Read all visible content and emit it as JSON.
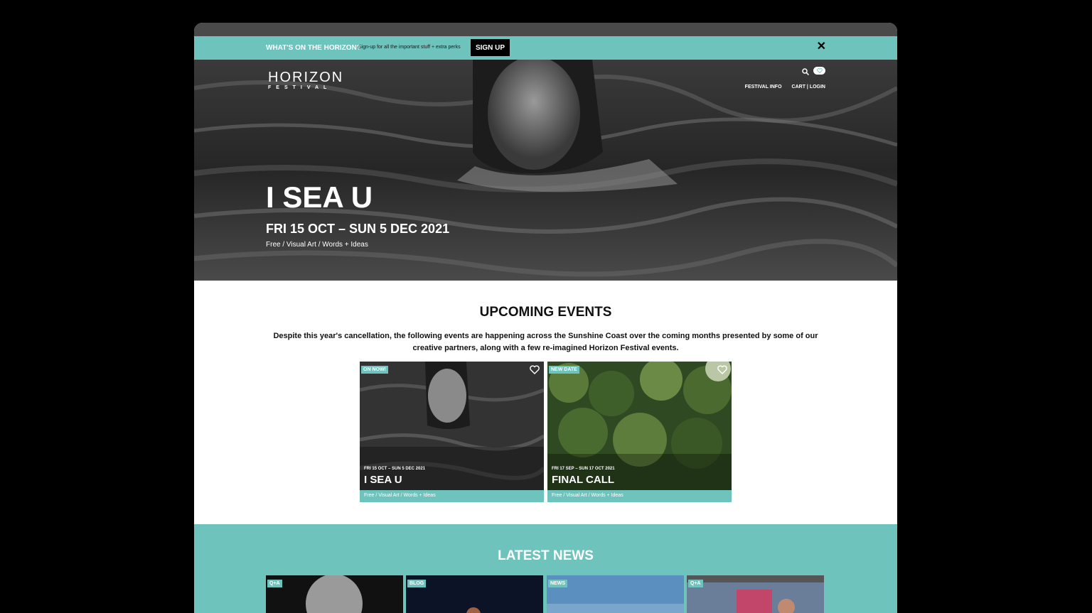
{
  "promo": {
    "question": "WHAT'S ON THE HORIZON?",
    "subtext": "Sign-up for all the important stuff + extra perks",
    "signup_label": "SIGN UP",
    "close_glyph": "✕"
  },
  "header": {
    "logo_line1": "HORIZON",
    "logo_line2": "FESTIVAL",
    "nav": [
      "FESTIVAL INFO",
      "CART | LOGIN"
    ]
  },
  "hero": {
    "title": "I SEA U",
    "dates": "FRI 15 OCT – SUN 5 DEC 2021",
    "tags": "Free / Visual Art / Words + Ideas"
  },
  "upcoming": {
    "heading": "UPCOMING EVENTS",
    "description": "Despite this year's cancellation, the following events are happening across the Sunshine Coast over the coming months presented by some of our creative partners, along with a few re-imagined Horizon Festival events.",
    "cards": [
      {
        "badge": "ON NOW!",
        "dates": "FRI 15 OCT – SUN 5 DEC 2021",
        "title": "I SEA U",
        "tags": "Free / Visual Art / Words + Ideas"
      },
      {
        "badge": "NEW DATE",
        "dates": "FRI 17 SEP – SUN 17 OCT 2021",
        "title": "FINAL CALL",
        "tags": "Free / Visual Art / Words + Ideas"
      }
    ]
  },
  "news": {
    "heading": "LATEST NEWS",
    "cards": [
      {
        "badge": "Q+A"
      },
      {
        "badge": "BLOG"
      },
      {
        "badge": "NEWS"
      },
      {
        "badge": "Q+A"
      }
    ]
  },
  "colors": {
    "accent": "#6ec3bc",
    "dark": "#000000"
  }
}
